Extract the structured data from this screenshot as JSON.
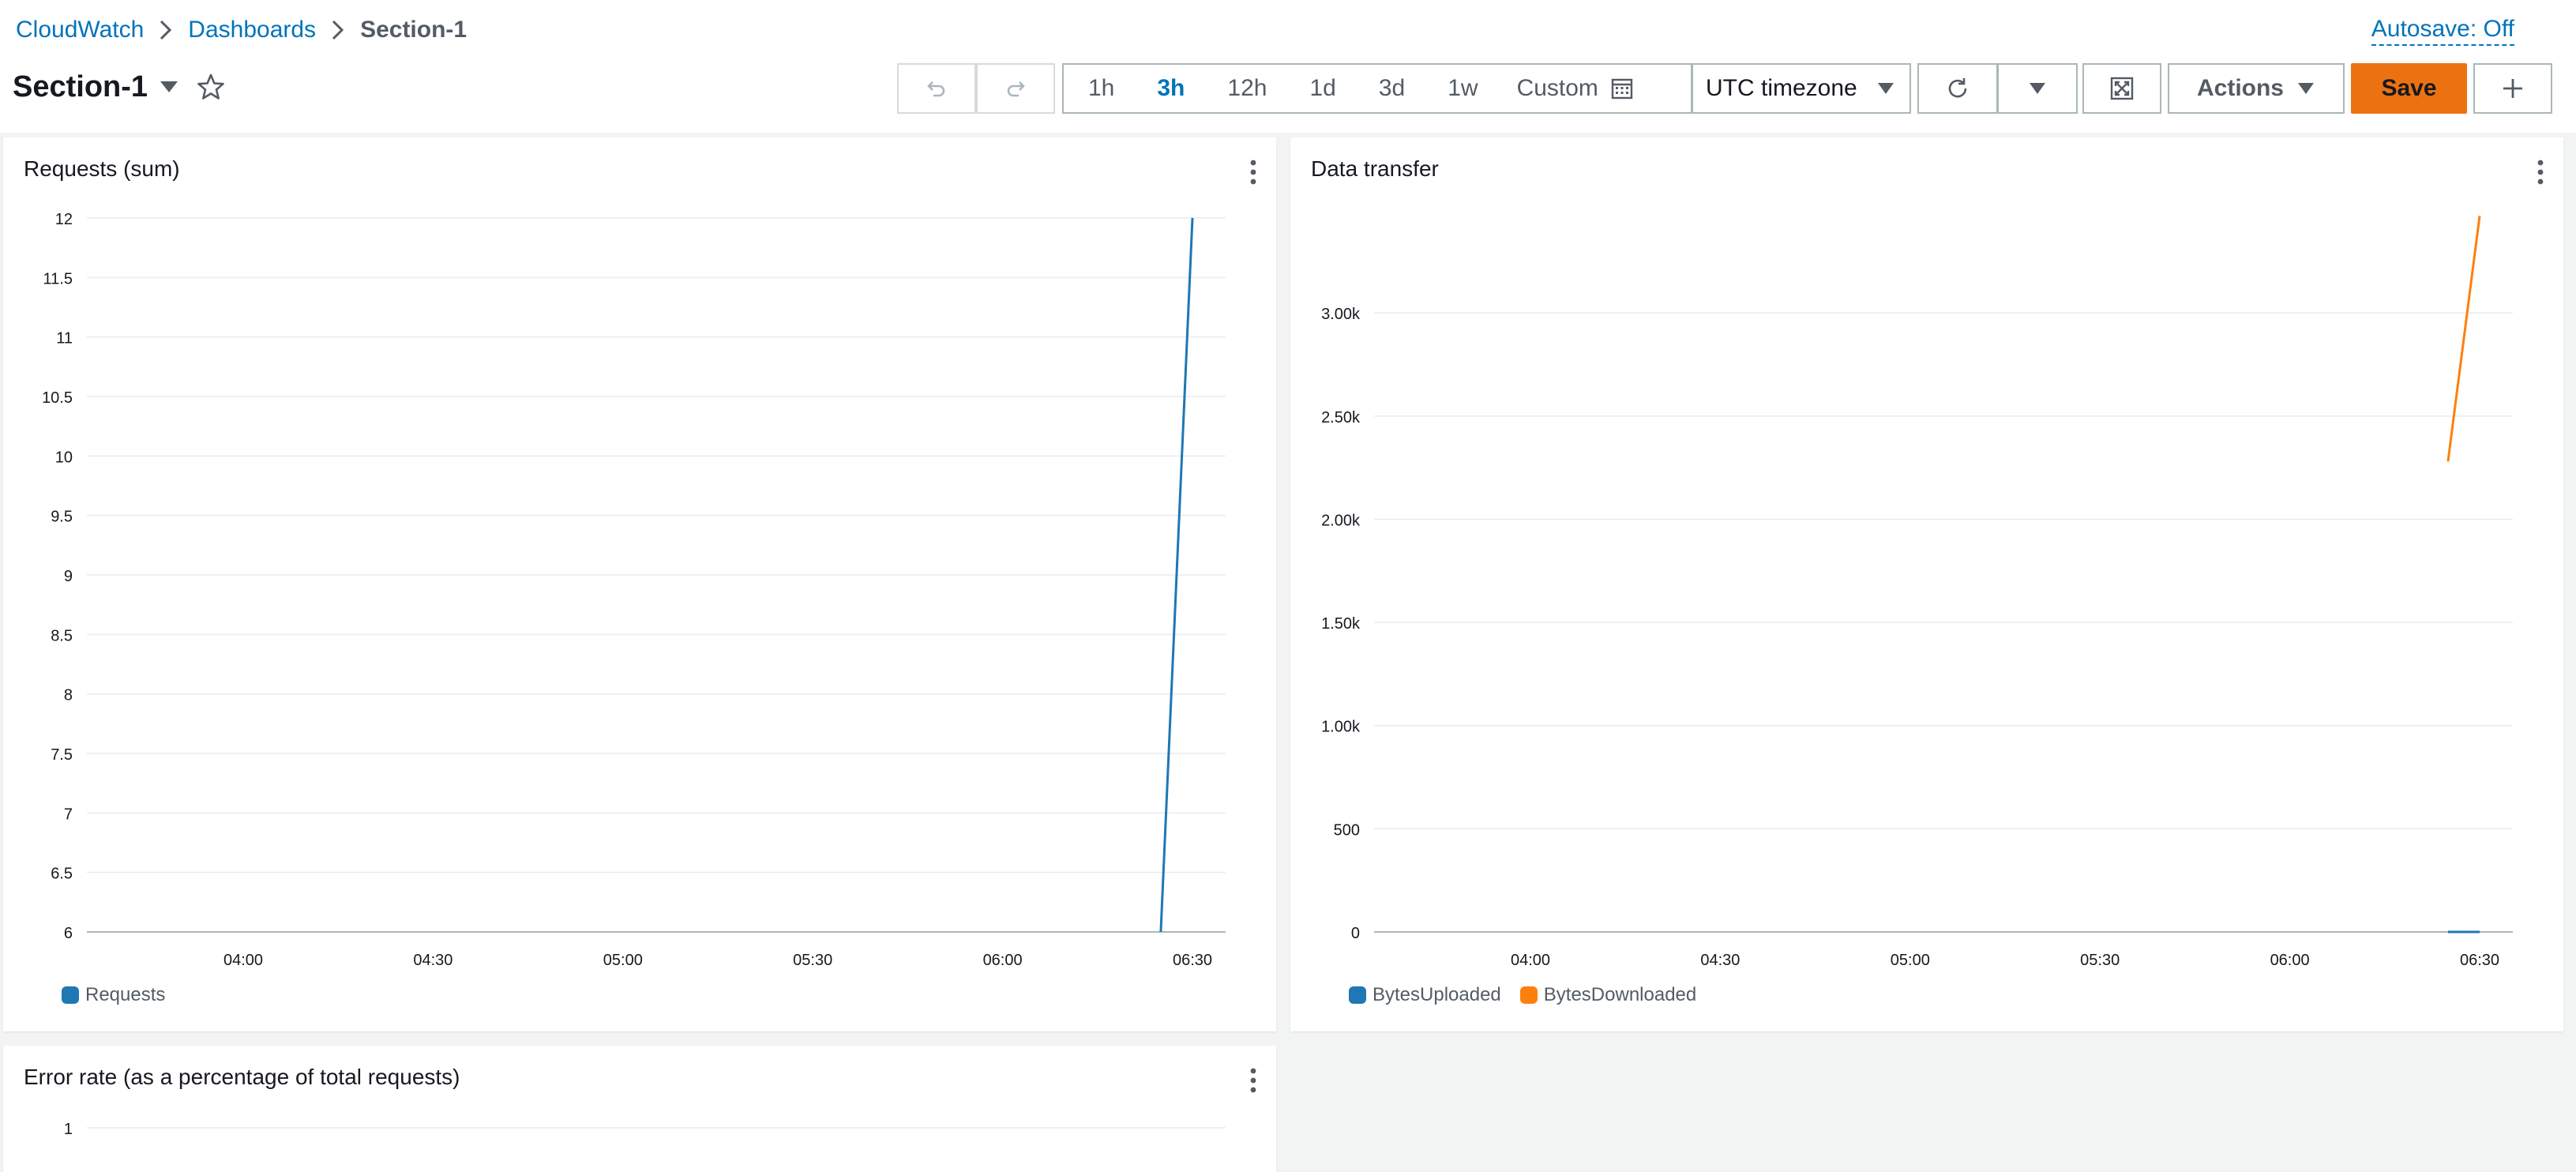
{
  "breadcrumb": {
    "items": [
      "CloudWatch",
      "Dashboards",
      "Section-1"
    ]
  },
  "autosave_label": "Autosave: Off",
  "page_title": "Section-1",
  "toolbar": {
    "time_ranges": [
      "1h",
      "3h",
      "12h",
      "1d",
      "3d",
      "1w"
    ],
    "active_range": "3h",
    "custom_label": "Custom",
    "timezone_value": "UTC timezone",
    "actions_label": "Actions",
    "save_label": "Save"
  },
  "icons": {
    "undo": "undo-icon",
    "redo": "redo-icon",
    "calendar": "calendar-icon",
    "refresh": "refresh-icon",
    "fullscreen": "fullscreen-icon",
    "add": "plus-icon",
    "favorite": "star-icon"
  },
  "colors": {
    "link": "#0073bb",
    "accent_button": "#ec7211",
    "series_blue": "#1f77b4",
    "series_orange": "#ff7f0e"
  },
  "widgets": [
    {
      "title": "Requests (sum)"
    },
    {
      "title": "Data transfer"
    },
    {
      "title": "Error rate (as a percentage of total requests)"
    }
  ],
  "chart_data": [
    {
      "type": "line",
      "title": "Requests (sum)",
      "x": [
        "04:00",
        "04:30",
        "05:00",
        "05:30",
        "06:00",
        "06:30"
      ],
      "x_ticks": [
        "04:00",
        "04:30",
        "05:00",
        "05:30",
        "06:00",
        "06:30"
      ],
      "y_ticks": [
        "6",
        "6.5",
        "7",
        "7.5",
        "8",
        "8.5",
        "9",
        "9.5",
        "10",
        "10.5",
        "11",
        "11.5",
        "12"
      ],
      "ylim": [
        6,
        12
      ],
      "grid": true,
      "legend_position": "bottom-left",
      "series": [
        {
          "name": "Requests",
          "color": "#1f77b4",
          "points": [
            {
              "x": "06:25",
              "y": 6
            },
            {
              "x": "06:30",
              "y": 12
            }
          ]
        }
      ]
    },
    {
      "type": "line",
      "title": "Data transfer",
      "x_ticks": [
        "04:00",
        "04:30",
        "05:00",
        "05:30",
        "06:00",
        "06:30"
      ],
      "y_ticks": [
        "0",
        "500",
        "1.00k",
        "1.50k",
        "2.00k",
        "2.50k",
        "3.00k"
      ],
      "ylim": [
        0,
        3460
      ],
      "grid": true,
      "legend_position": "bottom-left",
      "series": [
        {
          "name": "BytesUploaded",
          "color": "#1f77b4",
          "points": [
            {
              "x": "06:25",
              "y": 0
            },
            {
              "x": "06:30",
              "y": 0
            }
          ]
        },
        {
          "name": "BytesDownloaded",
          "color": "#ff7f0e",
          "points": [
            {
              "x": "06:25",
              "y": 2280
            },
            {
              "x": "06:30",
              "y": 3470
            }
          ]
        }
      ]
    },
    {
      "type": "line",
      "title": "Error rate (as a percentage of total requests)",
      "y_ticks": [
        "1"
      ],
      "grid": true,
      "series": []
    }
  ]
}
